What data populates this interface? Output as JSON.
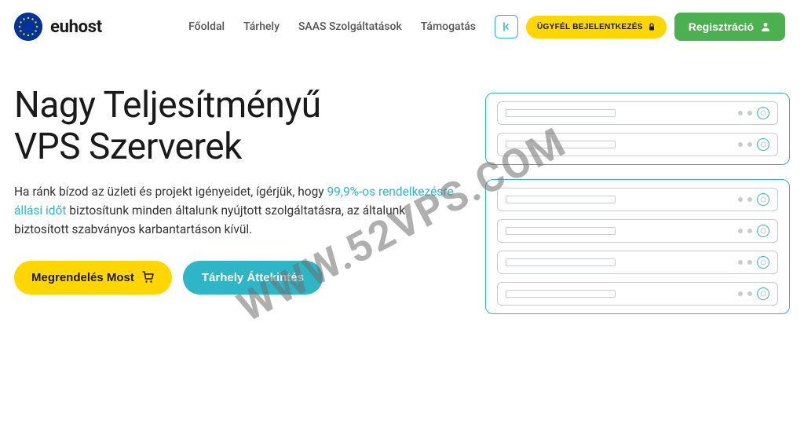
{
  "brand": {
    "name": "euhost"
  },
  "nav": {
    "items": [
      {
        "label": "Főoldal"
      },
      {
        "label": "Tárhely"
      },
      {
        "label": "SAAS Szolgáltatások"
      },
      {
        "label": "Támogatás"
      }
    ],
    "login_label": "ÜGYFÉL BEJELENTKEZÉS",
    "register_label": "Regisztráció"
  },
  "hero": {
    "title_line1": "Nagy Teljesítményű",
    "title_line2": "VPS Szerverek",
    "desc_prefix": "Ha ránk bízod az üzleti és projekt igényeidet, ígérjük, hogy ",
    "desc_highlight": "99,9%-os rendelkezésre állási időt",
    "desc_suffix": " biztosítunk minden általunk nyújtott szolgáltatásra, az általunk biztosított szabványos karbantartáson kívül.",
    "cta_primary": "Megrendelés Most",
    "cta_secondary": "Tárhely Áttekintés"
  },
  "watermark": "WWW.52VPS.COM",
  "colors": {
    "accent": "#2fb6c6",
    "yellow": "#ffd600",
    "green": "#4caf50",
    "eu_blue": "#003399"
  }
}
